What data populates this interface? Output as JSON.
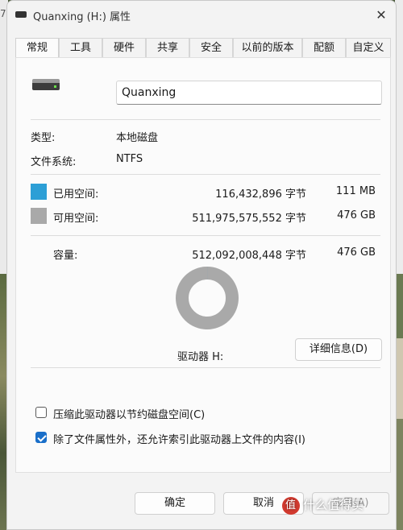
{
  "window": {
    "title": "Quanxing (H:) 属性",
    "close_glyph": "✕"
  },
  "tabs": [
    {
      "label": "常规",
      "active": true
    },
    {
      "label": "工具"
    },
    {
      "label": "硬件"
    },
    {
      "label": "共享"
    },
    {
      "label": "安全"
    },
    {
      "label": "以前的版本"
    },
    {
      "label": "配额"
    },
    {
      "label": "自定义"
    }
  ],
  "general": {
    "volume_name": "Quanxing",
    "type_label": "类型:",
    "type_value": "本地磁盘",
    "fs_label": "文件系统:",
    "fs_value": "NTFS",
    "used_label": "已用空间:",
    "used_bytes": "116,432,896 字节",
    "used_size": "111 MB",
    "free_label": "可用空间:",
    "free_bytes": "511,975,575,552 字节",
    "free_size": "476 GB",
    "capacity_label": "容量:",
    "capacity_bytes": "512,092,008,448 字节",
    "capacity_size": "476 GB",
    "drive_label": "驱动器 H:",
    "details_button": "详细信息(D)",
    "compress_label": "压缩此驱动器以节约磁盘空间(C)",
    "compress_checked": false,
    "index_label": "除了文件属性外，还允许索引此驱动器上文件的内容(I)",
    "index_checked": true
  },
  "usage": {
    "used_fraction": 0.000227,
    "used_color": "#2c9fd6",
    "free_color": "#a9a9a9"
  },
  "footer": {
    "ok_label": "确定",
    "cancel_label": "取消",
    "apply_label": "应用(A)"
  },
  "watermark": {
    "text": "什么值得买"
  },
  "background": {
    "left_fragment": "7"
  }
}
